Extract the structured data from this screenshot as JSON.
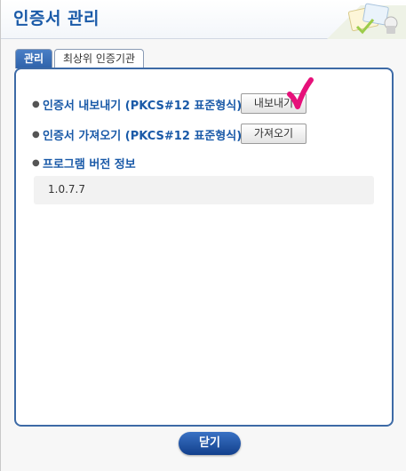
{
  "window": {
    "title": "인증서 관리"
  },
  "tabs": [
    {
      "label": "관리",
      "active": true
    },
    {
      "label": "최상위 인증기관",
      "active": false
    }
  ],
  "export": {
    "label": "인증서 내보내기 (PKCS#12 표준형식)",
    "button": "내보내기"
  },
  "import": {
    "label": "인증서 가져오기 (PKCS#12 표준형식)",
    "button": "가져오기"
  },
  "version": {
    "label": "프로그램 버전 정보",
    "value": "1.0.7.7"
  },
  "footer": {
    "close_label": "닫기"
  },
  "colors": {
    "accent": "#1a5aa8",
    "panel_border": "#3d6aa6",
    "check_mark": "#e6117a"
  },
  "icons": [
    "bullet-icon",
    "check-mark-icon",
    "certificate-decoration-icon"
  ]
}
